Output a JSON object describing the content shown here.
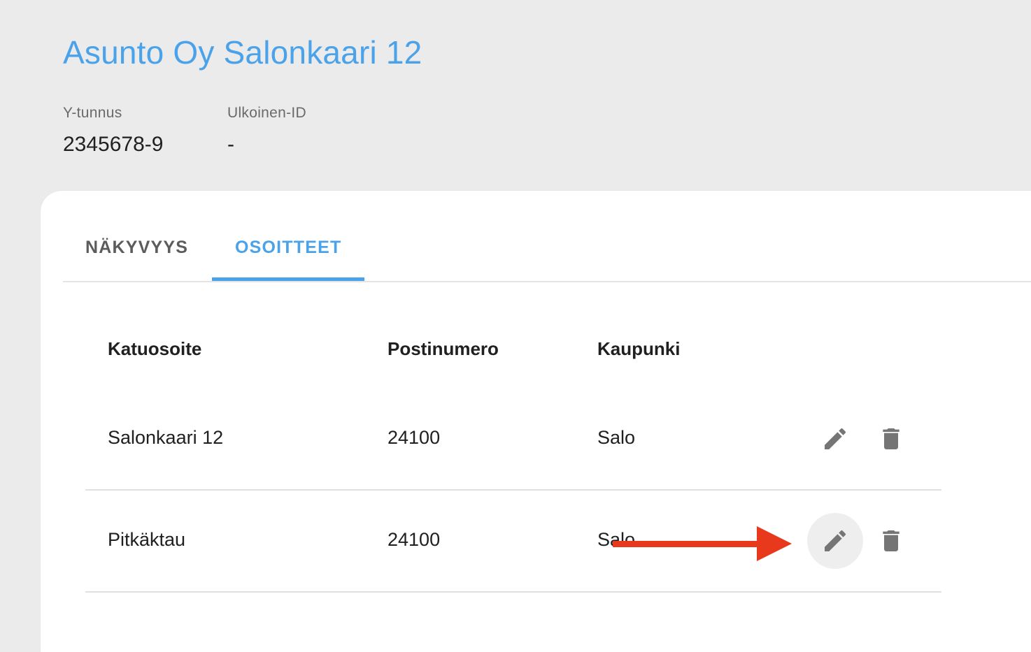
{
  "header": {
    "title": "Asunto Oy Salonkaari 12",
    "fields": [
      {
        "label": "Y-tunnus",
        "value": "2345678-9"
      },
      {
        "label": "Ulkoinen-ID",
        "value": "-"
      }
    ]
  },
  "tabs": [
    {
      "label": "NÄKYVYYS",
      "active": false
    },
    {
      "label": "OSOITTEET",
      "active": true
    }
  ],
  "table": {
    "columns": [
      "Katuosoite",
      "Postinumero",
      "Kaupunki"
    ],
    "rows": [
      {
        "street": "Salonkaari 12",
        "postal": "24100",
        "city": "Salo"
      },
      {
        "street": "Pitkäktau",
        "postal": "24100",
        "city": "Salo"
      }
    ]
  },
  "icons": {
    "edit": "pencil-icon",
    "delete": "trash-icon"
  },
  "colors": {
    "accent": "#4aa3ea",
    "annotation_arrow": "#e8391c",
    "icon": "#757575"
  }
}
